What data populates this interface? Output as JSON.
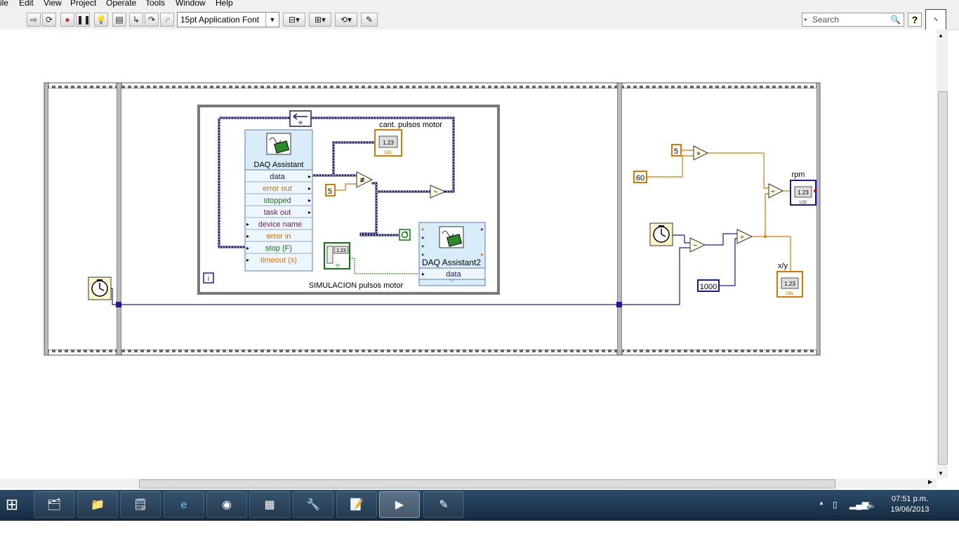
{
  "menu": {
    "items": [
      "ile",
      "Edit",
      "View",
      "Project",
      "Operate",
      "Tools",
      "Window",
      "Help"
    ]
  },
  "toolbar": {
    "font_selector": "15pt Application Font",
    "search_placeholder": "Search",
    "icons": [
      "run-arrow-icon",
      "run-continuous-icon",
      "abort-icon",
      "pause-icon",
      "highlight-bulb-icon",
      "retain-wire-icon",
      "step-into-icon",
      "step-over-icon",
      "step-out-icon",
      "align-icon",
      "distribute-icon",
      "reorder-icon",
      "cleanup-icon"
    ]
  },
  "diagram": {
    "while_loop_label": "SIMULACION pulsos motor",
    "iteration_terminal": "i",
    "daq1": {
      "title": "DAQ Assistant",
      "terminals": [
        "data",
        "error out",
        "stopped",
        "task out",
        "device name",
        "error in",
        "stop (F)",
        "timeout (s)"
      ]
    },
    "daq2": {
      "title": "DAQ Assistant2",
      "terminals": [
        "data"
      ]
    },
    "indicators": {
      "cant_pulsos": "cant. pulsos motor",
      "rpm": "rpm",
      "xy": "x/y"
    },
    "indicator_glyph": "1.23",
    "indicator_types": {
      "dbl": "DBL",
      "u32": "U32"
    },
    "constants": {
      "five_inner": "5",
      "five_outer": "5",
      "sixty": "60",
      "thousand": "1000"
    },
    "bool_const": {
      "glyph": "1.23",
      "type": "TF"
    },
    "operators": {
      "not_equal": "≠",
      "multiply": "×",
      "divide1": "÷",
      "divide2": "÷",
      "subtract": "−"
    },
    "colors": {
      "wire_dbl": "#e07800",
      "wire_int": "#1a1aa0",
      "wire_bool": "#0b7a0b",
      "frame": "#555555",
      "daq_bg": "#d8ecfa"
    }
  },
  "taskbar": {
    "buttons": [
      "start-orb",
      "explorer-folder",
      "file-manager",
      "sticky-notes",
      "internet-explorer",
      "chrome",
      "calculator",
      "tools",
      "notes",
      "labview",
      "draw"
    ],
    "time": "07:51 p.m.",
    "date": "19/06/2013"
  }
}
